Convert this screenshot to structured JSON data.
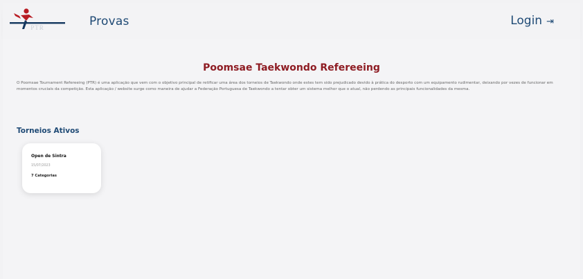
{
  "header": {
    "logo_text": "PTR",
    "nav_provas": "Provas",
    "nav_login": "Login",
    "login_icon": "login-arrow-icon"
  },
  "main": {
    "title": "Poomsae Taekwondo Refereeing",
    "intro": "O Poomsae Tournament Refereeing (PTR) é uma aplicação que vem com o objetivo principal de retificar uma área dos torneios de Taekwondo onde estes tem sido prejudicado devido à prática do desporto com um equipamento rudimentar, deixando por vezes de funcionar em momentos cruciais da competição. Esta aplicação / website surge como maneira de ajudar a Federação Portuguesa de Taekwondo a tentar obter um sistema melhor que o atual, não perdendo as principais funcionalidades da mesma.",
    "section_title": "Torneios Ativos",
    "tournaments": [
      {
        "name": "Open de Sintra",
        "date": "15/07/2023",
        "categories": "7 Categorias"
      }
    ]
  },
  "colors": {
    "brand_blue": "#1f4a75",
    "brand_red": "#8e1c23"
  }
}
